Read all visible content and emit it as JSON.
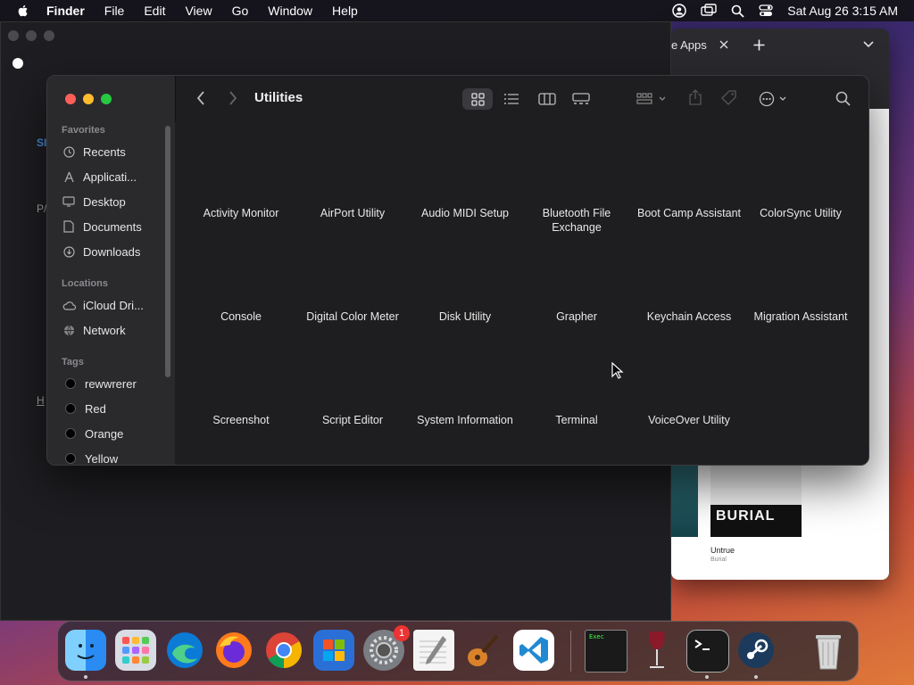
{
  "menubar": {
    "app_name": "Finder",
    "menus": [
      "File",
      "Edit",
      "View",
      "Go",
      "Window",
      "Help"
    ],
    "datetime": "Sat Aug 26  3:15 AM"
  },
  "browser": {
    "tab_label": "e Apps",
    "album_title": "Untrue",
    "album_artist": "Burial",
    "album_art_text": "BURIAL"
  },
  "bg_window": {
    "fragments": [
      "S",
      "SI",
      "P/",
      "H"
    ]
  },
  "finder": {
    "title": "Utilities",
    "sidebar": {
      "favorites_header": "Favorites",
      "favorites": [
        {
          "label": "Recents",
          "icon": "clock-icon"
        },
        {
          "label": "Applicati...",
          "icon": "applications-icon"
        },
        {
          "label": "Desktop",
          "icon": "desktop-icon"
        },
        {
          "label": "Documents",
          "icon": "document-icon"
        },
        {
          "label": "Downloads",
          "icon": "download-icon"
        }
      ],
      "locations_header": "Locations",
      "locations": [
        {
          "label": "iCloud Dri...",
          "icon": "cloud-icon"
        },
        {
          "label": "Network",
          "icon": "globe-icon"
        }
      ],
      "tags_header": "Tags",
      "tags": [
        "rewwrerer",
        "Red",
        "Orange",
        "Yellow"
      ]
    },
    "items": [
      [
        "Activity Monitor",
        "AirPort Utility",
        "Audio MIDI Setup",
        "Bluetooth File Exchange",
        "Boot Camp Assistant",
        "ColorSync Utility"
      ],
      [
        "Console",
        "Digital Color Meter",
        "Disk Utility",
        "Grapher",
        "Keychain Access",
        "Migration Assistant"
      ],
      [
        "Screenshot",
        "Script Editor",
        "System Information",
        "Terminal",
        "VoiceOver Utility"
      ]
    ]
  },
  "dock": {
    "apps": [
      "Finder",
      "Launchpad",
      "Microsoft Edge",
      "Firefox",
      "Google Chrome",
      "Microsoft Store",
      "System Settings",
      "TextEdit",
      "GarageBand",
      "Visual Studio Code",
      "Exec",
      "Wine",
      "Terminal",
      "Steam",
      "Trash"
    ],
    "settings_badge": "1"
  },
  "colors": {
    "close": "#ff5f57",
    "minimize": "#febc2e",
    "zoom": "#28c840"
  }
}
